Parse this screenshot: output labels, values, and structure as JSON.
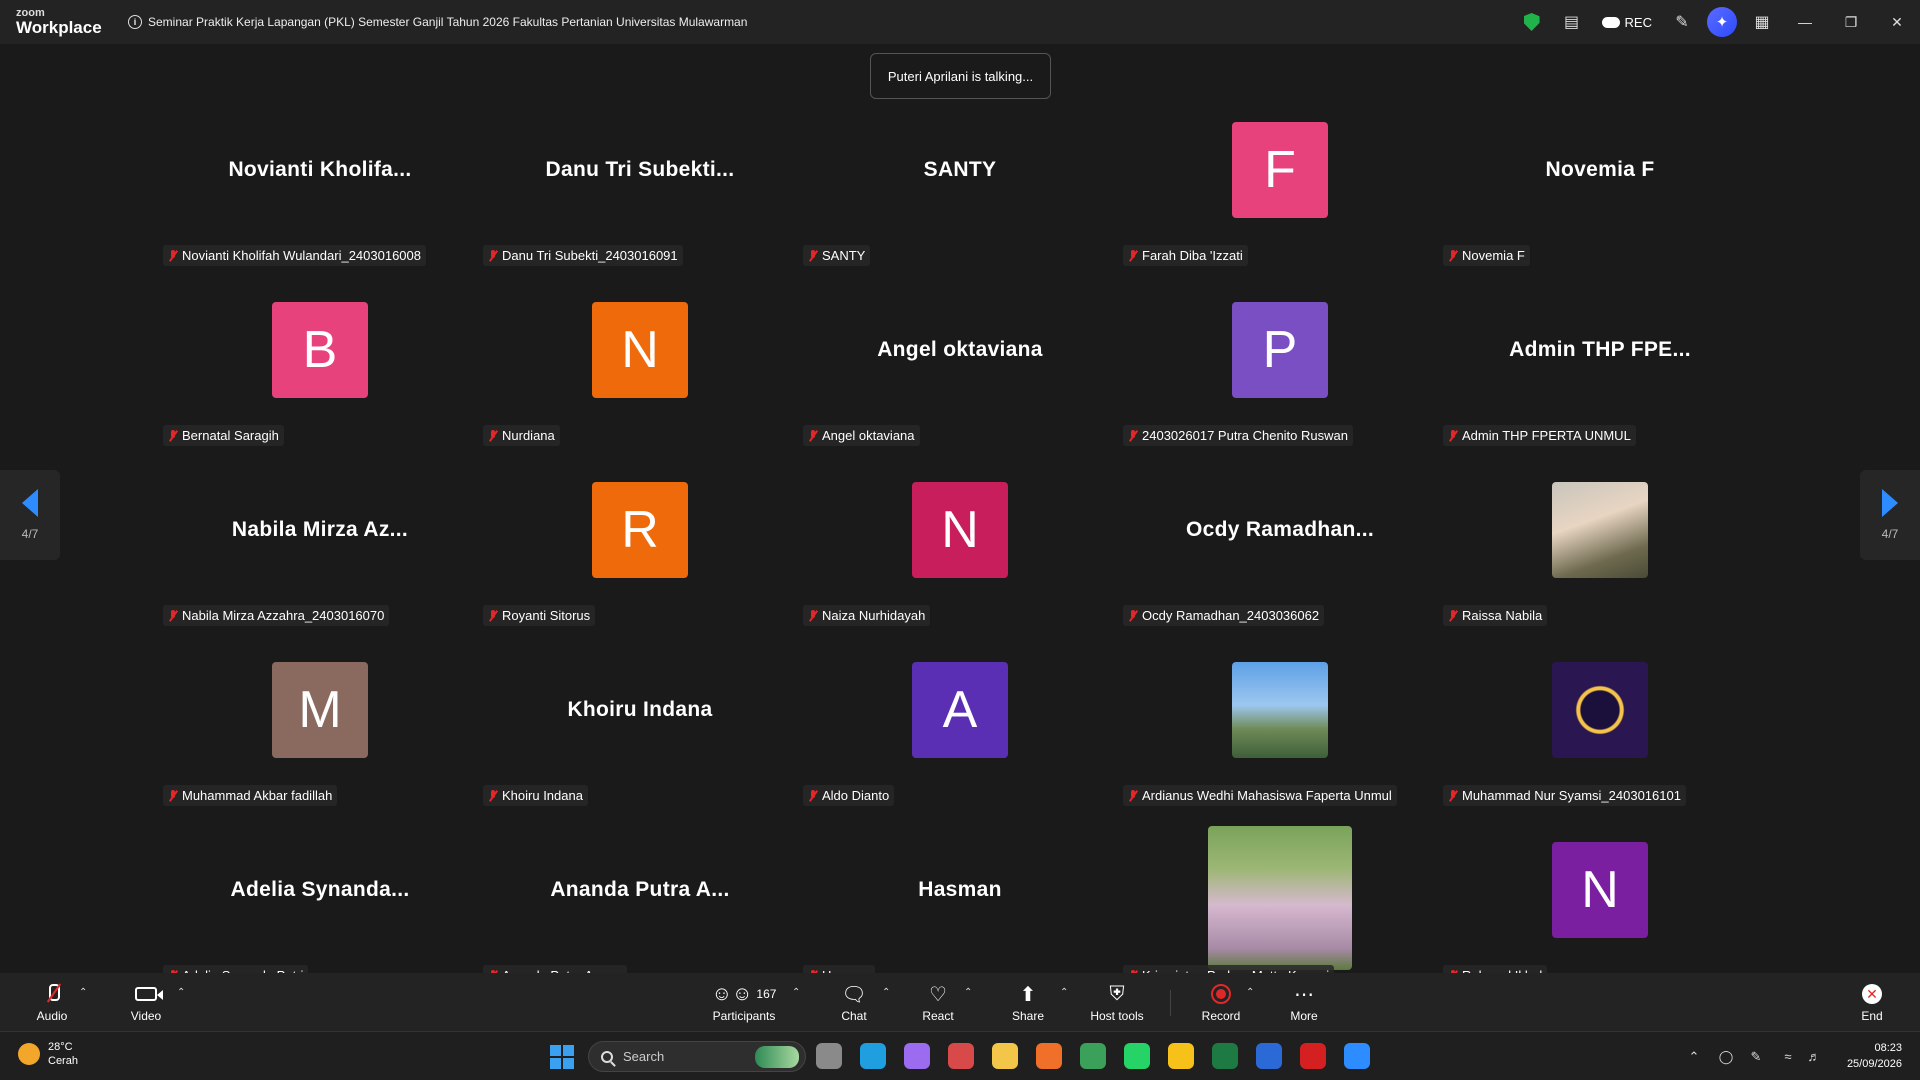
{
  "titlebar": {
    "logo_small": "zoom",
    "logo_big": "Workplace",
    "meeting_title": "Seminar Praktik Kerja Lapangan (PKL) Semester Ganjil Tahun 2026 Fakultas Pertanian Universitas Mulawarman",
    "rec_label": "REC",
    "icons": [
      "info-icon",
      "shield-icon",
      "notes-icon",
      "cloud-icon",
      "pen-icon",
      "ai-companion-icon",
      "apps-grid-icon",
      "minimize-icon",
      "restore-icon",
      "close-icon"
    ]
  },
  "talking_indicator": "Puteri Aprilani is talking...",
  "pagination": {
    "left": "4/7",
    "right": "4/7"
  },
  "participants": [
    {
      "display": "Novianti  Kholifa...",
      "label": "Novianti Kholifah Wulandari_2403016008"
    },
    {
      "display": "Danu Tri Subekti...",
      "label": "Danu Tri Subekti_2403016091"
    },
    {
      "display": "SANTY",
      "label": "SANTY"
    },
    {
      "initial": "F",
      "color": "#e8427c",
      "label": "Farah Diba 'Izzati"
    },
    {
      "display": "Novemia F",
      "label": "Novemia F"
    },
    {
      "initial": "B",
      "color": "#e8427c",
      "label": "Bernatal Saragih"
    },
    {
      "initial": "N",
      "color": "#ee6a0a",
      "label": "Nurdiana"
    },
    {
      "display": "Angel oktaviana",
      "label": "Angel oktaviana"
    },
    {
      "initial": "P",
      "color": "#7a4fc4",
      "label": "2403026017 Putra Chenito Ruswan"
    },
    {
      "display": "Admin THP FPE...",
      "label": "Admin THP FPERTA UNMUL"
    },
    {
      "display": "Nabila Mirza Az...",
      "label": "Nabila Mirza Azzahra_2403016070"
    },
    {
      "initial": "R",
      "color": "#ee6a0a",
      "label": "Royanti Sitorus"
    },
    {
      "initial": "N",
      "color": "#c81e5c",
      "label": "Naiza Nurhidayah"
    },
    {
      "display": "Ocdy  Ramadhan...",
      "label": "Ocdy Ramadhan_2403036062"
    },
    {
      "photo": "ph-raissa",
      "label": "Raissa Nabila"
    },
    {
      "initial": "M",
      "color": "#8a6a5f",
      "label": "Muhammad Akbar fadillah"
    },
    {
      "display": "Khoiru Indana",
      "label": "Khoiru Indana"
    },
    {
      "initial": "A",
      "color": "#5a2fb4",
      "label": "Aldo Dianto"
    },
    {
      "photo": "ph-ardianus",
      "label": "Ardianus Wedhi Mahasiswa Faperta Unmul"
    },
    {
      "photo": "ph-nur",
      "label": "Muhammad Nur Syamsi_2403016101"
    },
    {
      "display": "Adelia  Synanda...",
      "label": "Adelia Synanda Putri"
    },
    {
      "display": "Ananda Putra A...",
      "label": "Ananda Putra Agung"
    },
    {
      "display": "Hasman",
      "label": "Hasman"
    },
    {
      "photo": "ph-krism",
      "tall": true,
      "label": "Krismiatun Padma Metta Komari"
    },
    {
      "initial": "N",
      "color": "#7a1fa0",
      "label": "Rahmad Ikbal"
    }
  ],
  "toolbar": {
    "audio": "Audio",
    "video": "Video",
    "participants": "Participants",
    "participants_count": "167",
    "chat": "Chat",
    "react": "React",
    "share": "Share",
    "host_tools": "Host tools",
    "record": "Record",
    "more": "More",
    "end": "End"
  },
  "taskbar": {
    "temperature": "28°C",
    "weather": "Cerah",
    "search_placeholder": "Search",
    "time": "08:23",
    "date": "25/09/2026",
    "apps": [
      {
        "name": "task-view-icon",
        "color": "#8a8a8a"
      },
      {
        "name": "edge-icon",
        "color": "#1f9ee0"
      },
      {
        "name": "copilot-icon",
        "color": "#9b6cf0"
      },
      {
        "name": "app-icon",
        "color": "#d84a4a"
      },
      {
        "name": "file-explorer-icon",
        "color": "#f3c64a"
      },
      {
        "name": "firefox-icon",
        "color": "#f0702a"
      },
      {
        "name": "chrome-icon",
        "color": "#3aa05a"
      },
      {
        "name": "whatsapp-icon",
        "color": "#25d366"
      },
      {
        "name": "app-yellow-icon",
        "color": "#f6c21a"
      },
      {
        "name": "excel-icon",
        "color": "#1e7a43"
      },
      {
        "name": "word-icon",
        "color": "#2b6ad6"
      },
      {
        "name": "acrobat-icon",
        "color": "#d42020"
      },
      {
        "name": "zoom-icon",
        "color": "#2d8cff"
      }
    ]
  }
}
